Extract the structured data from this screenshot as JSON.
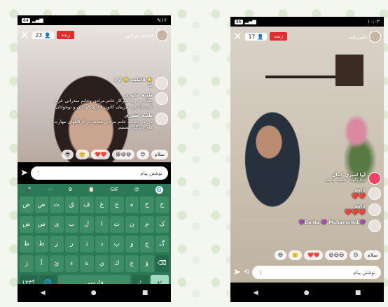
{
  "labels": {
    "live": "زنده",
    "message_placeholder": "نوشتن پیام",
    "gif": "GIF"
  },
  "icons": {
    "close": "✕",
    "person": "👤",
    "send": "➤",
    "more": "⋮",
    "mic": "🎤",
    "dots": "⋯",
    "gear": "⚙",
    "clipboard": "📋",
    "sticker": "☺",
    "google": "G",
    "backspace": "⌫",
    "globe": "🌐",
    "enter": "↵",
    "back": "◀",
    "home": "●",
    "recents": "■",
    "switch": "⟲"
  },
  "reactions": [
    "سلام",
    "😊",
    "😆😆😆",
    "❤️❤️",
    "🙂",
    "😎"
  ],
  "p1": {
    "battery": "84",
    "time": "۹:۱۶",
    "viewers": "23",
    "host": "حامده مرادی",
    "comments": [
      {
        "name": "فاطمه ⭐ آزاد ⭐",
        "text": "بله"
      },
      {
        "name": "طیبه غفوری",
        "text": "سلام و درود سرکار خانم مرادی وخانم منذرانی عزیز کارشناسان ومربیان کانون فکری کودکان و نوجوانان"
      },
      {
        "name": "طیبه غفوری",
        "text": "من در خدمت خانم مرادی هستم درکارگاههای مهارت های زندگی هستیم"
      }
    ]
  },
  "p2": {
    "battery": "86",
    "time": "۱۰:۰۲",
    "viewers": "17",
    "host": "شیرزایی",
    "comments": [
      {
        "name": "آوا امیری کمال",
        "text": "خدا نگهدار خسته نباشید"
      },
      {
        "name": "ayin",
        "text": "❤️❤️"
      },
      {
        "name": "ayin",
        "text": "❤️❤️❤️"
      },
      {
        "name": "💜Behta 💜 Mohammedi💜",
        "text": ""
      }
    ]
  },
  "keys": {
    "r1": [
      "ض",
      "ص",
      "ث",
      "ق",
      "ف",
      "غ",
      "ع",
      "ه",
      "خ",
      "ح"
    ],
    "r2": [
      "ش",
      "س",
      "ی",
      "ب",
      "ل",
      "ا",
      "ت",
      "ن",
      "م",
      "ک"
    ],
    "r3": [
      "ظ",
      "ط",
      "ز",
      "ر",
      "ذ",
      "د",
      "پ",
      "و",
      "چ",
      "گ"
    ],
    "r4": [
      "ژ",
      "آ",
      "ئ",
      "ء",
      "ة",
      "ي",
      "ك",
      "ج",
      "ؤ"
    ],
    "r5": {
      "symbols": "؟۱۲۳",
      "space": "فارسی",
      "punct": "،؛."
    }
  }
}
